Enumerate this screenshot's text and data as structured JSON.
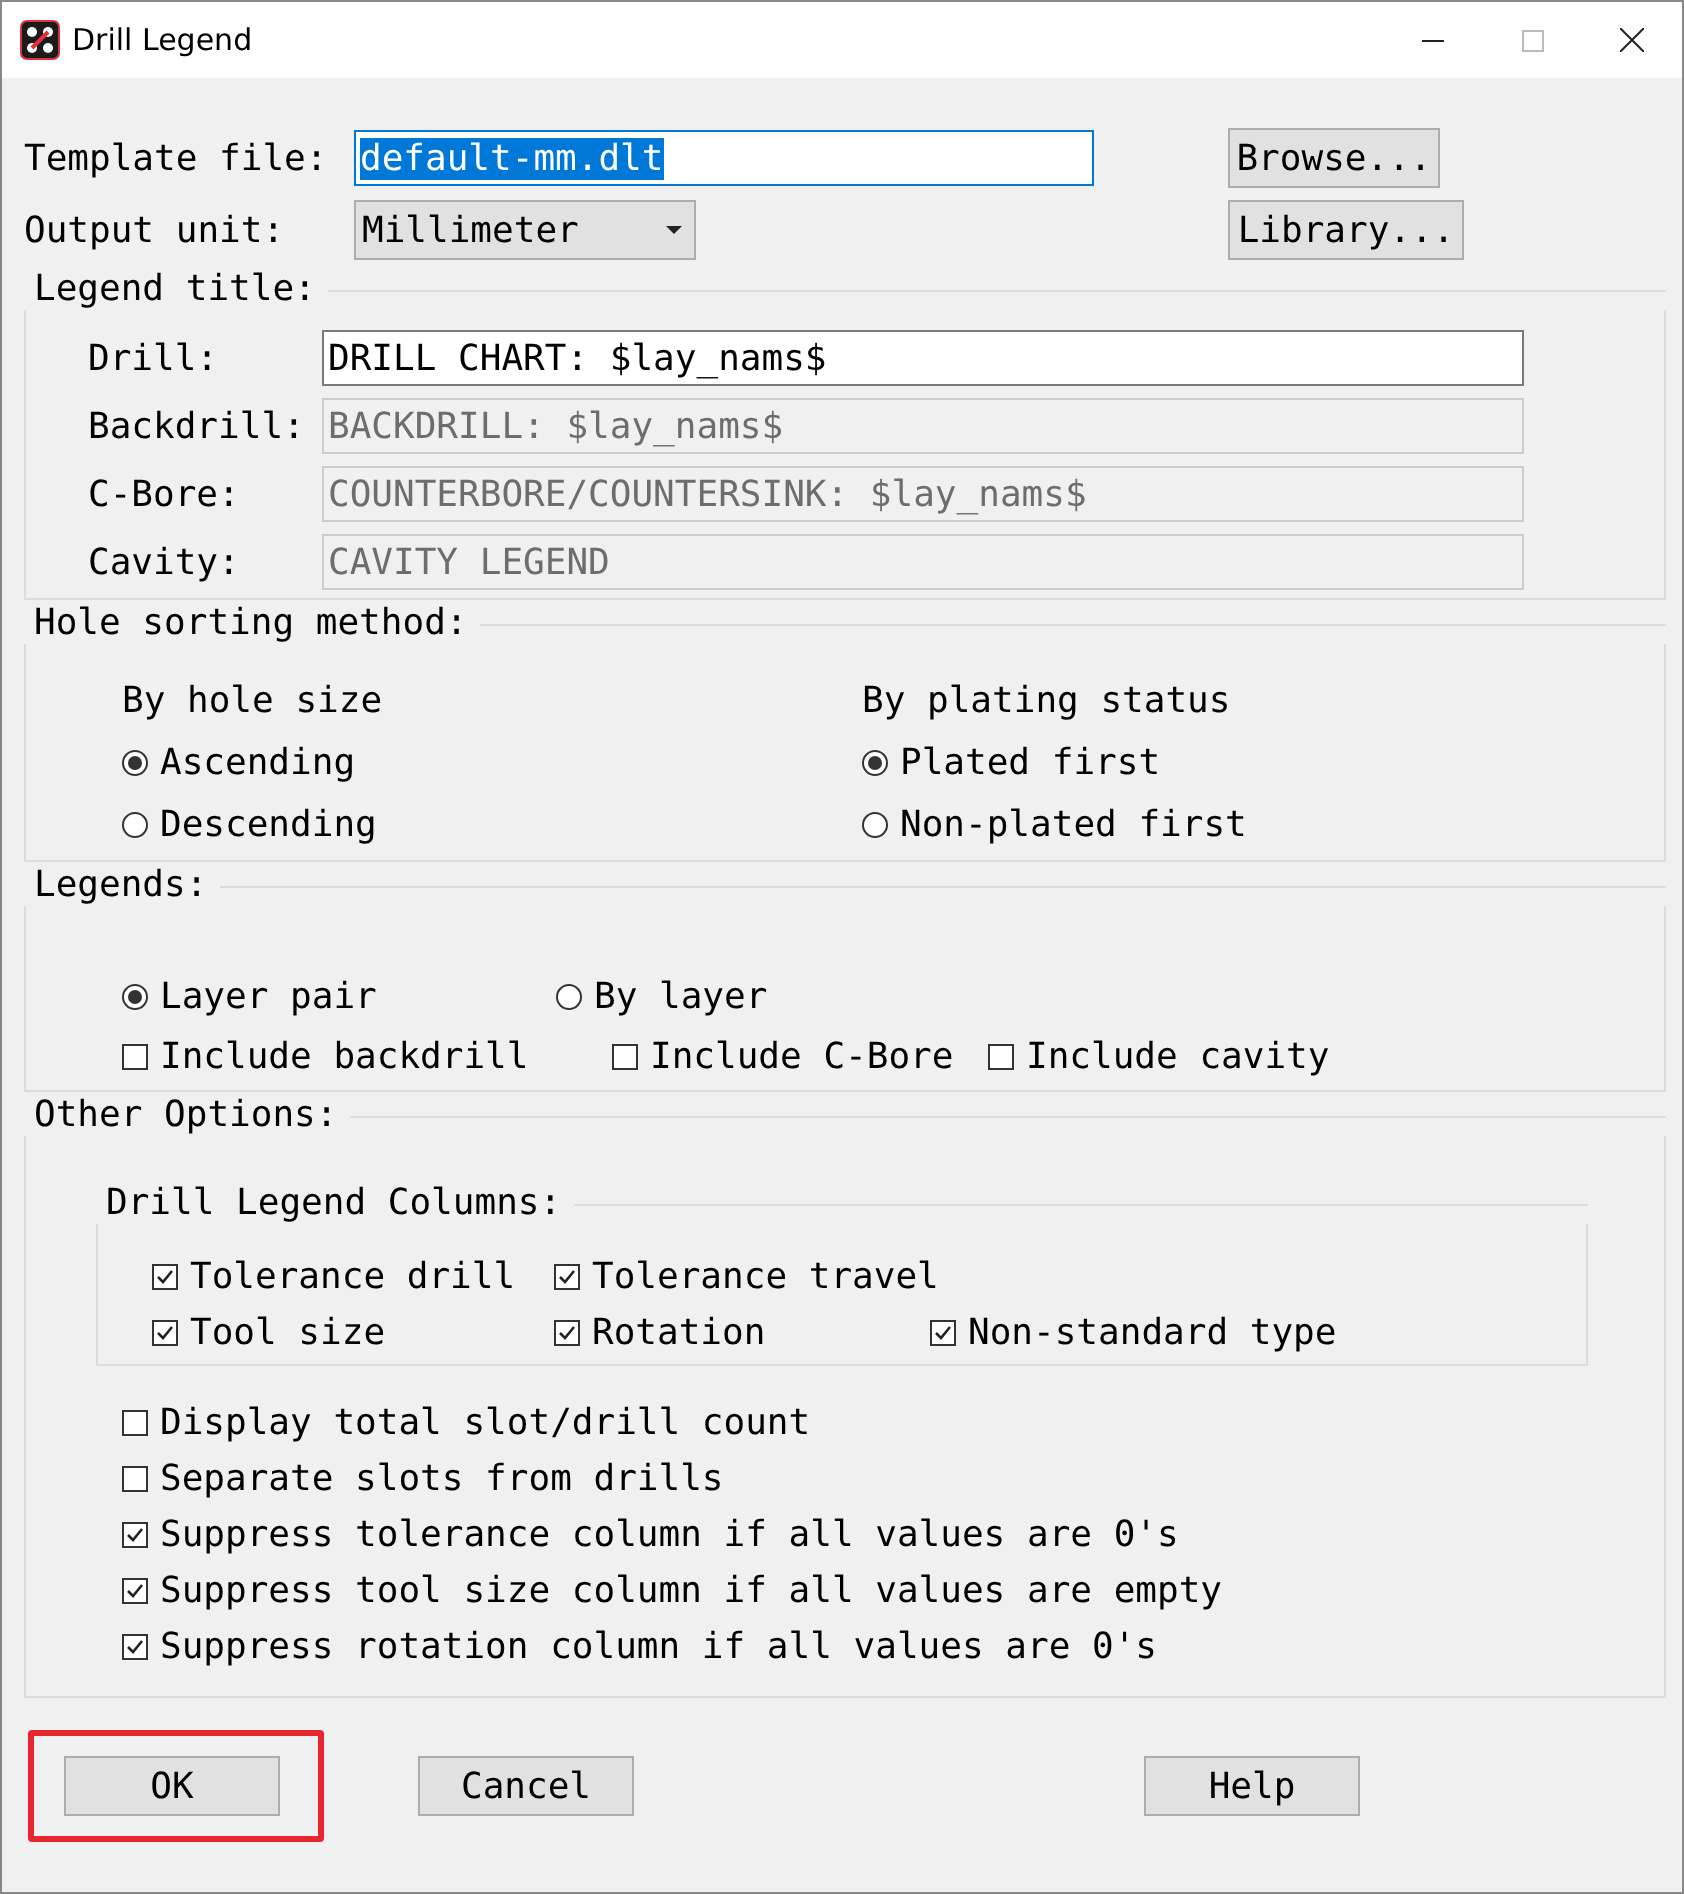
{
  "window": {
    "title": "Drill Legend"
  },
  "template_file": {
    "label": "Template file:",
    "value": "default-mm.dlt",
    "selected": true
  },
  "browse_button": "Browse...",
  "output_unit": {
    "label": "Output unit:",
    "value": "Millimeter"
  },
  "library_button": "Library...",
  "legend_title": {
    "heading": "Legend title:",
    "fields": [
      {
        "label": "Drill:",
        "value": "DRILL CHART: $lay_nams$",
        "disabled": false
      },
      {
        "label": "Backdrill:",
        "value": "BACKDRILL: $lay_nams$",
        "disabled": true
      },
      {
        "label": "C-Bore:",
        "value": "COUNTERBORE/COUNTERSINK: $lay_nams$",
        "disabled": true
      },
      {
        "label": "Cavity:",
        "value": "CAVITY LEGEND",
        "disabled": true
      }
    ]
  },
  "hole_sorting": {
    "heading": "Hole sorting method:",
    "columns": [
      {
        "heading": "By hole size",
        "options": [
          {
            "label": "Ascending",
            "selected": true
          },
          {
            "label": "Descending",
            "selected": false
          }
        ]
      },
      {
        "heading": "By plating status",
        "options": [
          {
            "label": "Plated first",
            "selected": true
          },
          {
            "label": "Non-plated first",
            "selected": false
          }
        ]
      }
    ]
  },
  "legends": {
    "heading": "Legends:",
    "radios": [
      {
        "label": "Layer pair",
        "selected": true
      },
      {
        "label": "By layer",
        "selected": false
      }
    ],
    "checkboxes": [
      {
        "label": "Include backdrill",
        "checked": false
      },
      {
        "label": "Include C-Bore",
        "checked": false
      },
      {
        "label": "Include cavity",
        "checked": false
      }
    ]
  },
  "other_options": {
    "heading": "Other Options:",
    "columns_group": {
      "heading": "Drill Legend Columns:",
      "rows": [
        [
          {
            "label": "Tolerance drill",
            "checked": true
          },
          {
            "label": "Tolerance travel",
            "checked": true
          }
        ],
        [
          {
            "label": "Tool size",
            "checked": true
          },
          {
            "label": "Rotation",
            "checked": true
          },
          {
            "label": "Non-standard type",
            "checked": true
          }
        ]
      ]
    },
    "options": [
      {
        "label": "Display total slot/drill count",
        "checked": false
      },
      {
        "label": "Separate slots from drills",
        "checked": false
      },
      {
        "label": "Suppress tolerance column if all values are 0's",
        "checked": true
      },
      {
        "label": "Suppress tool size column if all values are empty",
        "checked": true
      },
      {
        "label": "Suppress rotation column if all values are 0's",
        "checked": true
      }
    ]
  },
  "buttons": [
    {
      "label": "OK",
      "highlighted": true
    },
    {
      "label": "Cancel",
      "highlighted": false
    },
    {
      "label": "Help",
      "highlighted": false
    }
  ]
}
